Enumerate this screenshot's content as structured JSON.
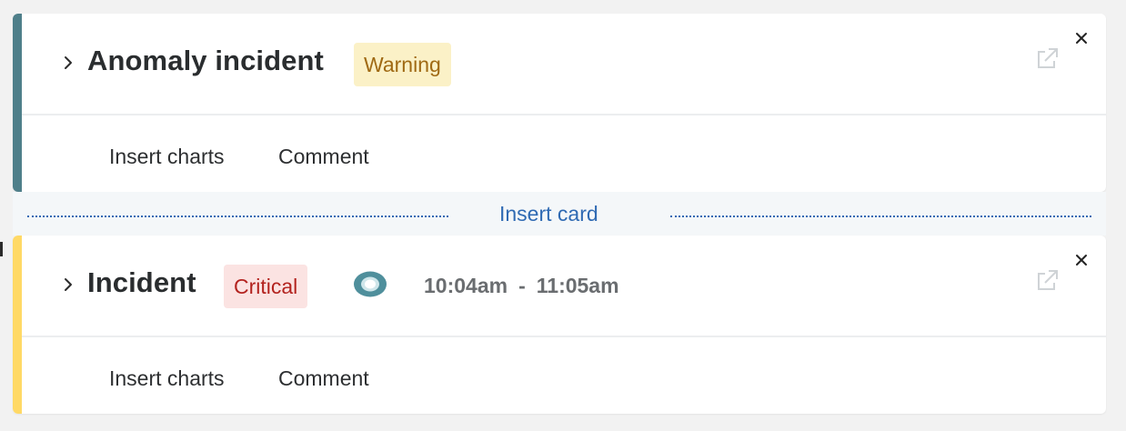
{
  "cards": [
    {
      "title": "Anomaly incident",
      "severity": "Warning",
      "accent_color": "#4f7f8a",
      "actions": {
        "insert_charts": "Insert charts",
        "comment": "Comment"
      },
      "icons": [
        "chevron-right-icon",
        "external-link-icon",
        "close-icon"
      ]
    },
    {
      "title": "Incident",
      "severity": "Critical",
      "accent_color": "#ffd966",
      "status_icon": "status-ring-icon",
      "time_start": "10:04am",
      "time_separator": "-",
      "time_end": "11:05am",
      "actions": {
        "insert_charts": "Insert charts",
        "comment": "Comment"
      },
      "icons": [
        "chevron-right-icon",
        "external-link-icon",
        "close-icon"
      ]
    }
  ],
  "insert_card": {
    "label": "Insert card",
    "color": "#2f6ab3"
  },
  "badge_colors": {
    "warning_bg": "#fbf1c7",
    "warning_text": "#a06a14",
    "critical_bg": "#fbe3e2",
    "critical_text": "#b3231f"
  }
}
